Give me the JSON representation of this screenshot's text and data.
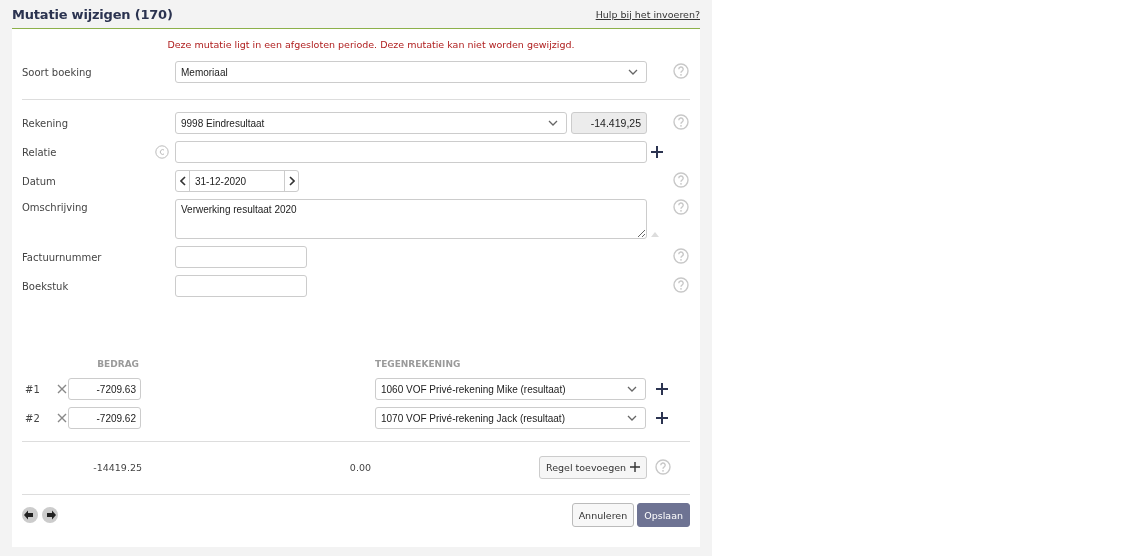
{
  "header": {
    "title": "Mutatie wijzigen (170)",
    "help_link": "Hulp bij het invoeren?"
  },
  "warning": "Deze mutatie ligt in een afgesloten periode. Deze mutatie kan niet worden gewijzigd.",
  "sections": [
    {
      "fields": [
        {
          "label": "Soort boeking",
          "kind": "select",
          "value": "Memoriaal",
          "help": true
        }
      ]
    },
    {
      "fields": [
        {
          "label": "Rekening",
          "kind": "select",
          "value": "9998 Eindresultaat",
          "balance": "-14.419,25",
          "help": true
        },
        {
          "label": "Relatie",
          "kind": "lookup",
          "add": true,
          "help": false
        },
        {
          "label": "Datum",
          "kind": "date",
          "value": "31-12-2020",
          "help": true
        },
        {
          "label": "Omschrijving",
          "kind": "textarea",
          "value": "Verwerking resultaat 2020",
          "help": true
        },
        {
          "label": "Factuurnummer",
          "kind": "text",
          "help": true
        },
        {
          "label": "Boekstuk",
          "kind": "text",
          "help": true
        }
      ]
    }
  ],
  "lines": {
    "columns": [
      "BEDRAG",
      "TEGENREKENING"
    ],
    "rows": [
      {
        "number": "#1",
        "amount": "-7209.63",
        "account": "1060 VOF Privé-rekening Mike (resultaat)"
      },
      {
        "number": "#2",
        "amount": "-7209.62",
        "account": "1070 VOF Privé-rekening Jack (resultaat)"
      }
    ],
    "total": "-14419.25",
    "difference": "0.00",
    "add_button": "Regel toevoegen"
  },
  "footer": {
    "buttons": [
      {
        "label": "Annuleren",
        "kind": "secondary"
      },
      {
        "label": "Opslaan",
        "kind": "primary"
      }
    ]
  }
}
